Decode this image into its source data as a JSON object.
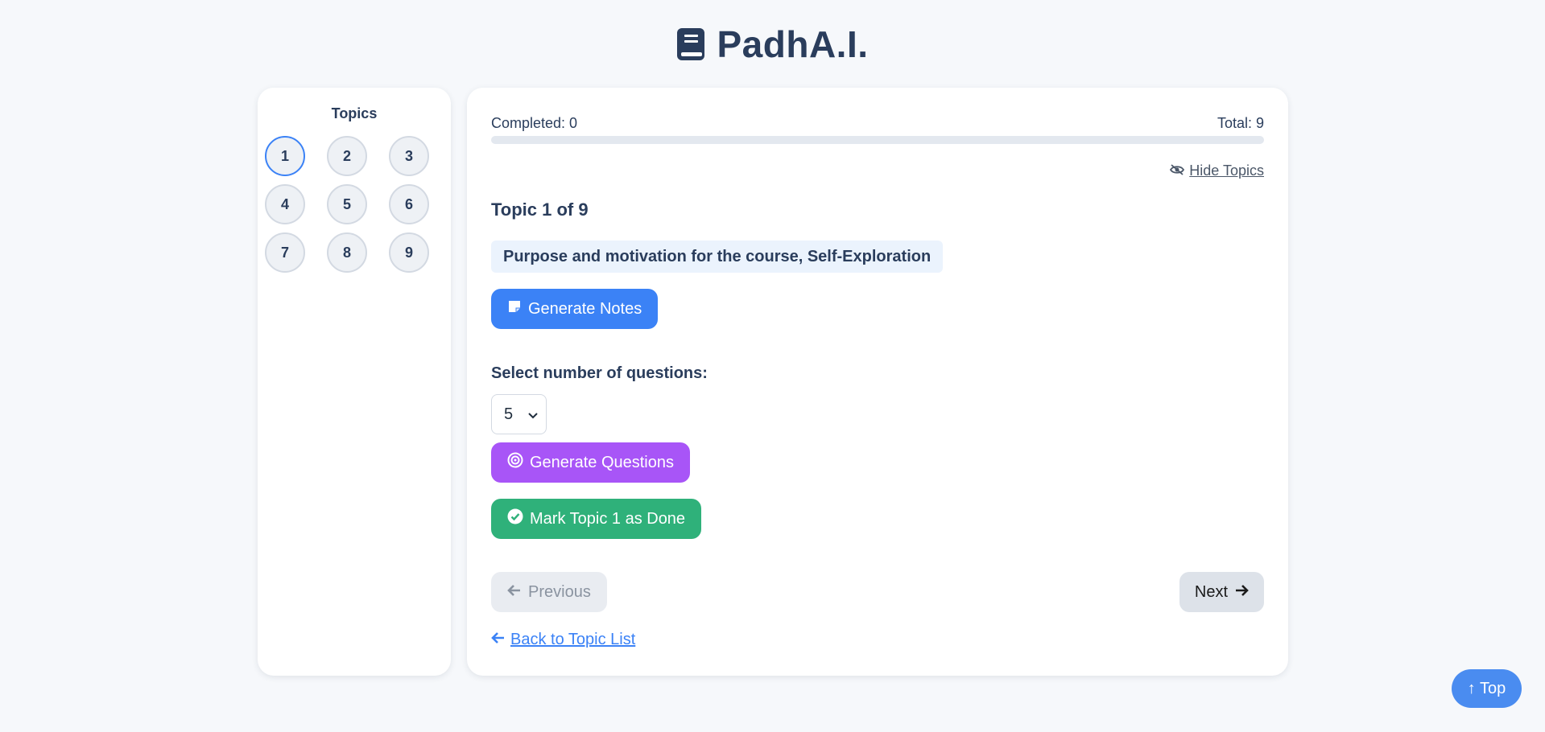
{
  "header": {
    "title": "PadhA.I.",
    "logo_icon": "book-icon"
  },
  "sidebar": {
    "title": "Topics",
    "topics": [
      "1",
      "2",
      "3",
      "4",
      "5",
      "6",
      "7",
      "8",
      "9"
    ],
    "active_topic": "1"
  },
  "progress": {
    "completed_label": "Completed: 0",
    "total_label": "Total: 9",
    "completed": 0,
    "total": 9
  },
  "hide_topics": {
    "label": "Hide Topics",
    "icon": "eye-slash-icon"
  },
  "topic": {
    "counter": "Topic 1 of 9",
    "name": "Purpose and motivation for the course, Self-Exploration"
  },
  "actions": {
    "generate_notes": "Generate Notes",
    "select_label": "Select number of questions:",
    "question_count": "5",
    "generate_questions": "Generate Questions",
    "mark_done": "Mark Topic 1 as Done"
  },
  "nav": {
    "previous": "Previous",
    "next": "Next",
    "back": "Back to Topic List"
  },
  "scroll_top": "↑ Top",
  "colors": {
    "accent": "#3b82f6",
    "questions": "#a855f7",
    "done": "#2fb17a",
    "title": "#2a3d5c"
  }
}
